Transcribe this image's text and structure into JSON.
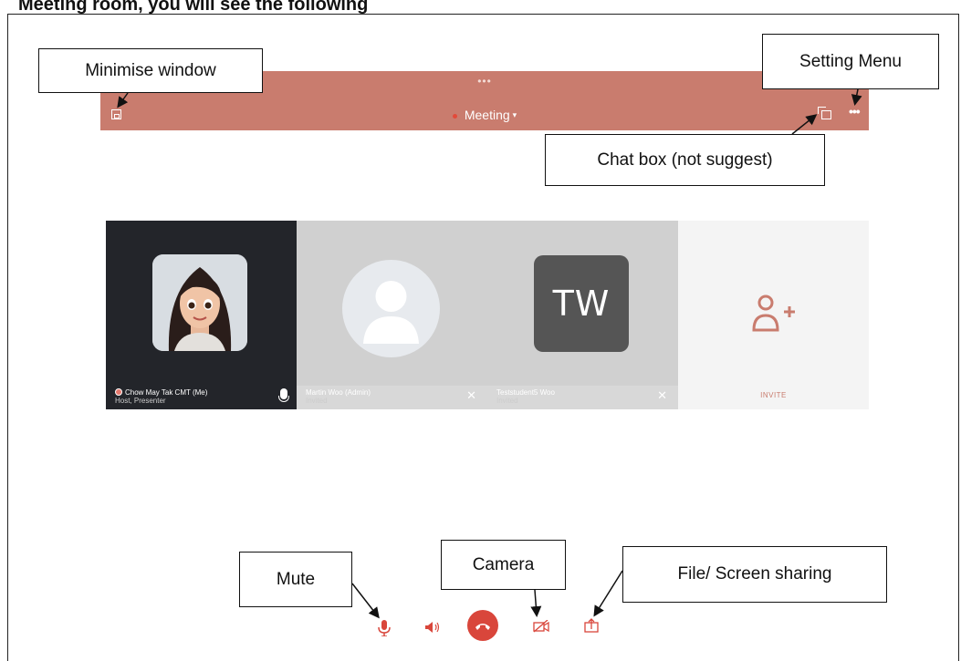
{
  "top_caption": "Meeting room, you will see the following",
  "titlebar": {
    "title": "Meeting",
    "accent_color": "#c97c6e"
  },
  "callouts": {
    "minimise": "Minimise window",
    "setting": "Setting Menu",
    "chat": "Chat box (not suggest)",
    "mute": "Mute",
    "camera": "Camera",
    "sharing": "File/ Screen sharing"
  },
  "participants": [
    {
      "name": "Chow May Tak CMT (Me)",
      "role": "Host, Presenter",
      "avatar": "portrait"
    },
    {
      "name": "Martin Woo (Admin)",
      "role": "Invited",
      "avatar": "generic-person"
    },
    {
      "name": "Teststudent5 Woo",
      "role": "Invited",
      "initials": "TW"
    }
  ],
  "invite": {
    "label": "INVITE",
    "icon": "add-person-icon"
  },
  "controls": [
    {
      "name": "mute",
      "icon": "microphone-icon"
    },
    {
      "name": "speaker",
      "icon": "speaker-icon"
    },
    {
      "name": "end-call",
      "icon": "hang-up-icon",
      "color": "#d9463b"
    },
    {
      "name": "camera",
      "icon": "camera-off-icon"
    },
    {
      "name": "share",
      "icon": "share-screen-icon"
    }
  ]
}
